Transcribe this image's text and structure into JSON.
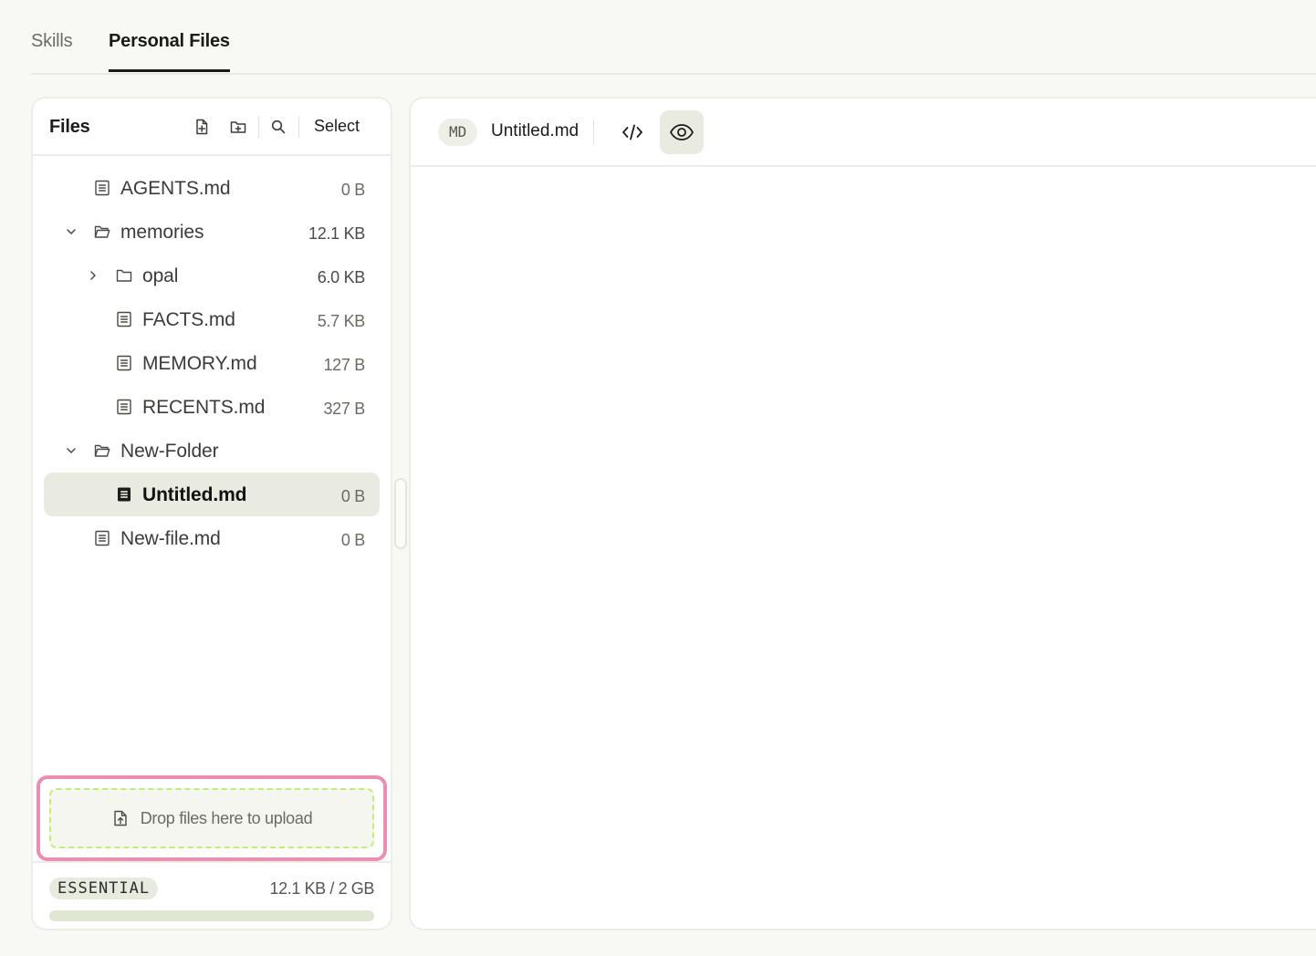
{
  "tabs": [
    {
      "label": "Skills",
      "active": false
    },
    {
      "label": "Personal Files",
      "active": true
    }
  ],
  "files_panel": {
    "title": "Files",
    "select_label": "Select",
    "tree": [
      {
        "name": "AGENTS.md",
        "size": "0 B",
        "kind": "file"
      },
      {
        "name": "memories",
        "size": "12.1 KB",
        "kind": "folder",
        "expanded": true
      },
      {
        "name": "opal",
        "size": "6.0 KB",
        "kind": "folder",
        "expanded": false
      },
      {
        "name": "FACTS.md",
        "size": "5.7 KB",
        "kind": "file"
      },
      {
        "name": "MEMORY.md",
        "size": "127 B",
        "kind": "file"
      },
      {
        "name": "RECENTS.md",
        "size": "327 B",
        "kind": "file"
      },
      {
        "name": "New-Folder",
        "size": "",
        "kind": "folder",
        "expanded": true
      },
      {
        "name": "Untitled.md",
        "size": "0 B",
        "kind": "file",
        "selected": true
      },
      {
        "name": "New-file.md",
        "size": "0 B",
        "kind": "file"
      }
    ],
    "upload_text": "Drop files here to upload",
    "plan_badge": "ESSENTIAL",
    "usage_text": "12.1 KB / 2 GB",
    "usage_fraction": 6e-06
  },
  "editor": {
    "format_badge": "MD",
    "file_name": "Untitled.md",
    "active_view": "preview"
  },
  "colors": {
    "background": "#f8f9f4",
    "selected_row": "#e9ebe1",
    "highlight_outline": "#ec8db2",
    "dropzone_dash": "#c6ea7a",
    "progress_track": "#dfe7d2"
  }
}
